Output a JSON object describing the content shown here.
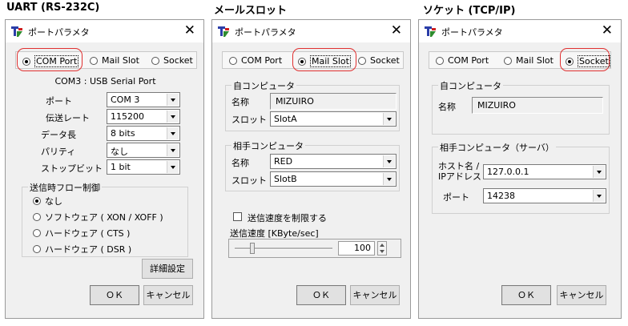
{
  "sections": {
    "uart": "UART (RS-232C)",
    "mailslot": "メールスロット",
    "socket": "ソケット (TCP/IP)"
  },
  "window": {
    "title": "ポートパラメタ",
    "close": "✕"
  },
  "conn_type": {
    "com_port": "COM Port",
    "mail_slot": "Mail Slot",
    "socket": "Socket"
  },
  "buttons": {
    "ok": "ＯＫ",
    "cancel": "キャンセル",
    "details": "詳細設定"
  },
  "uart": {
    "selected": "com_port",
    "port_desc": "COM3 : USB Serial Port",
    "labels": {
      "port": "ポート",
      "baud": "伝送レート",
      "data": "データ長",
      "parity": "パリティ",
      "stop": "ストップビット"
    },
    "values": {
      "port": "COM 3",
      "baud": "115200",
      "data": "8 bits",
      "parity": "なし",
      "stop": "1 bit"
    },
    "flow": {
      "title": "送信時フロー制御",
      "options": [
        "なし",
        "ソフトウェア ( XON / XOFF )",
        "ハードウェア ( CTS )",
        "ハードウェア ( DSR )"
      ],
      "selected_index": 0
    }
  },
  "mailslot": {
    "selected": "mail_slot",
    "local": {
      "title": "自コンピュータ",
      "name_label": "名称",
      "name_value": "MIZUIRO",
      "slot_label": "スロット",
      "slot_value": "SlotA"
    },
    "remote": {
      "title": "相手コンピュータ",
      "name_label": "名称",
      "name_value": "RED",
      "slot_label": "スロット",
      "slot_value": "SlotB"
    },
    "limit_check_label": "送信速度を制限する",
    "limit_checked": false,
    "speed_label": "送信速度 [KByte/sec]",
    "speed_value": "100",
    "speed_fraction": 0.18
  },
  "socket": {
    "selected": "socket",
    "local": {
      "title": "自コンピュータ",
      "name_label": "名称",
      "name_value": "MIZUIRO"
    },
    "remote": {
      "title": "相手コンピュータ（サーバ）",
      "host_label_1": "ホスト名 /",
      "host_label_2": "IPアドレス",
      "host_value": "127.0.0.1",
      "port_label": "ポート",
      "port_value": "14238"
    }
  },
  "colors": {
    "highlight_oval": "#e03030",
    "dialog_bg": "#f0f0f0"
  }
}
